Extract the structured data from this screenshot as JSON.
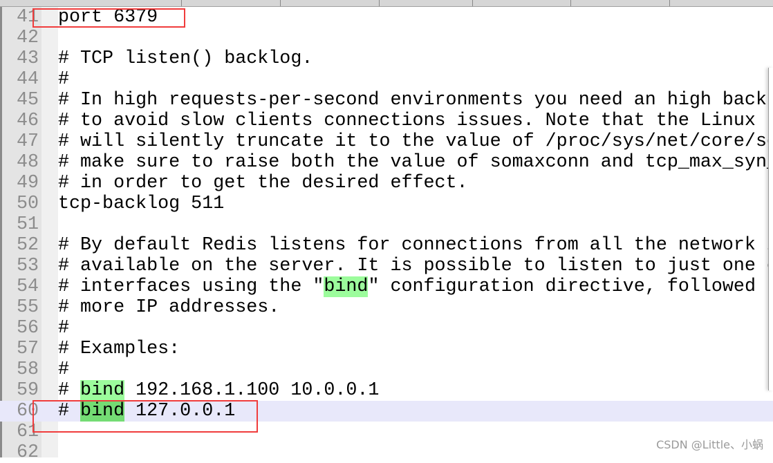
{
  "editor": {
    "current_line": 60,
    "highlight_colors": {
      "match": "#9cfc9c",
      "selected_match": "#74dc74",
      "current_line": "#e8e8fa",
      "annotation_box": "#f03c3c"
    },
    "lines": [
      {
        "n": "41",
        "segs": [
          {
            "t": "port 6379"
          }
        ]
      },
      {
        "n": "42",
        "segs": []
      },
      {
        "n": "43",
        "segs": [
          {
            "t": "# TCP listen() backlog."
          }
        ]
      },
      {
        "n": "44",
        "segs": [
          {
            "t": "#"
          }
        ]
      },
      {
        "n": "45",
        "segs": [
          {
            "t": "# In high requests-per-second environments you need an high back"
          }
        ]
      },
      {
        "n": "46",
        "segs": [
          {
            "t": "# to avoid slow clients connections issues. Note that the Linux k"
          }
        ]
      },
      {
        "n": "47",
        "segs": [
          {
            "t": "# will silently truncate it to the value of /proc/sys/net/core/so"
          }
        ]
      },
      {
        "n": "48",
        "segs": [
          {
            "t": "# make sure to raise both the value of somaxconn and tcp_max_syn_"
          }
        ]
      },
      {
        "n": "49",
        "segs": [
          {
            "t": "# in order to get the desired effect."
          }
        ]
      },
      {
        "n": "50",
        "segs": [
          {
            "t": "tcp-backlog 511"
          }
        ]
      },
      {
        "n": "51",
        "segs": []
      },
      {
        "n": "52",
        "segs": [
          {
            "t": "# By default Redis listens for connections from all the network i"
          }
        ]
      },
      {
        "n": "53",
        "segs": [
          {
            "t": "# available on the server. It is possible to listen to just one o"
          }
        ]
      },
      {
        "n": "54",
        "segs": [
          {
            "t": "# interfaces using the \""
          },
          {
            "t": "bind",
            "hl": "match"
          },
          {
            "t": "\" configuration directive, followed b"
          }
        ]
      },
      {
        "n": "55",
        "segs": [
          {
            "t": "# more IP addresses."
          }
        ]
      },
      {
        "n": "56",
        "segs": [
          {
            "t": "#"
          }
        ]
      },
      {
        "n": "57",
        "segs": [
          {
            "t": "# Examples:"
          }
        ]
      },
      {
        "n": "58",
        "segs": [
          {
            "t": "#"
          }
        ]
      },
      {
        "n": "59",
        "segs": [
          {
            "t": "# "
          },
          {
            "t": "bind",
            "hl": "match"
          },
          {
            "t": " 192.168.1.100 10.0.0.1"
          }
        ]
      },
      {
        "n": "60",
        "segs": [
          {
            "t": "# "
          },
          {
            "t": "bind",
            "hl": "sel"
          },
          {
            "t": " 127.0.0.1"
          }
        ]
      },
      {
        "n": "61",
        "segs": []
      },
      {
        "n": "62",
        "segs": []
      }
    ]
  },
  "watermark": "CSDN @Little、小蜗"
}
